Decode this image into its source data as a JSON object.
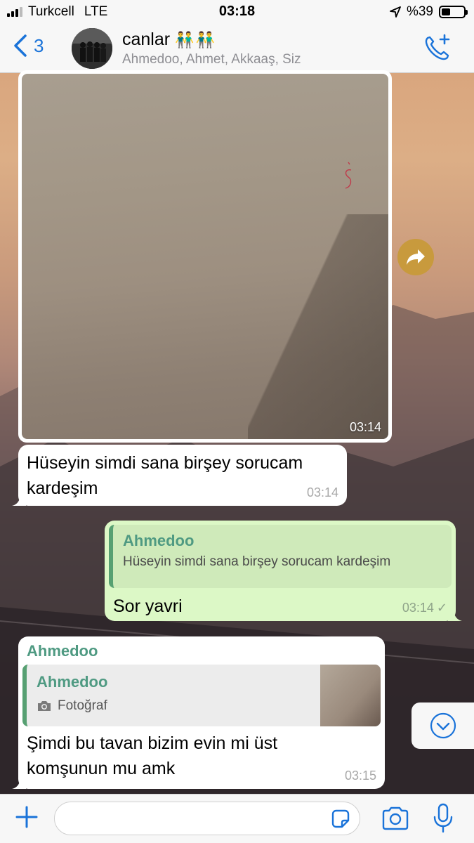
{
  "status_bar": {
    "carrier": "Turkcell",
    "network": "LTE",
    "time": "03:18",
    "battery": "%39",
    "battery_level": 0.39,
    "icons": [
      "signal-icon",
      "location-arrow-icon",
      "battery-icon"
    ]
  },
  "header": {
    "back_count": "3",
    "title": "canlar",
    "title_emoji": "👬👬",
    "subtitle": "Ahmedoo, Ahmet, Akkaaş, Siz",
    "icons": [
      "back-chevron-icon",
      "group-avatar",
      "add-call-icon"
    ]
  },
  "messages": {
    "photo": {
      "time": "03:14"
    },
    "m1": {
      "text": "Hüseyin simdi sana birşey sorucam kardeşim",
      "time": "03:14"
    },
    "m2": {
      "quote_name": "Ahmedoo",
      "quote_text": "Hüseyin simdi sana birşey sorucam kardeşim",
      "text": "Sor yavri",
      "time": "03:14",
      "check": "✓"
    },
    "m3": {
      "sender": "Ahmedoo",
      "quote_name": "Ahmedoo",
      "quote_text": "Fotoğraf",
      "text": "Şimdi bu tavan bizim evin mi üst komşunun mu amk",
      "time": "03:15"
    }
  },
  "input_bar": {
    "placeholder": "",
    "icons": [
      "plus-icon",
      "sticker-icon",
      "camera-icon",
      "microphone-icon"
    ]
  },
  "colors": {
    "accent": "#1a73d9",
    "outgoing_bubble": "#dcf8c6",
    "quote_name": "#4f9a82",
    "forward_button": "#c89a3d"
  }
}
